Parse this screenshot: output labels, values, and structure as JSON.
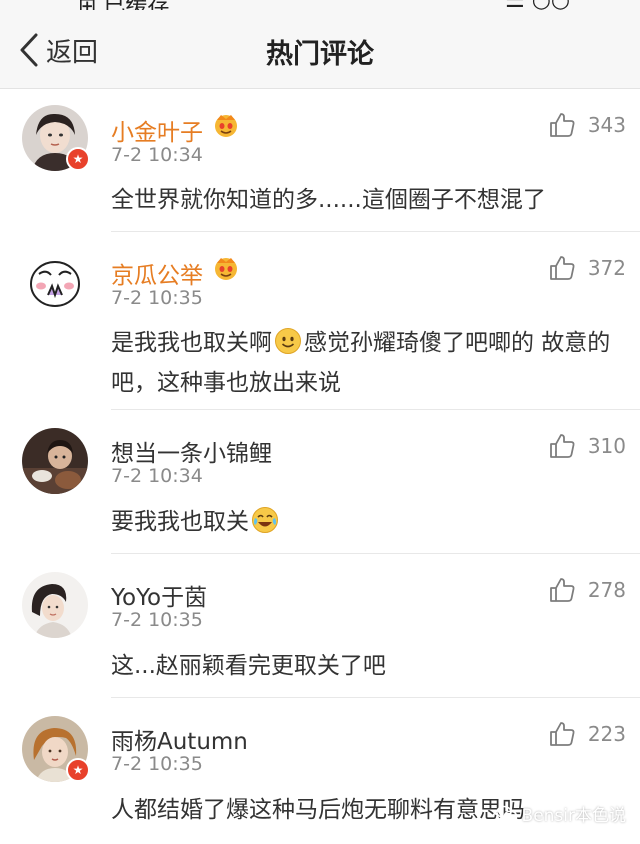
{
  "status_bar": {
    "fragments": [
      "⊞ 已缓存",
      "☰ ○○"
    ]
  },
  "navbar": {
    "back_label": "返回",
    "title": "热门评论"
  },
  "comments": [
    {
      "name": "小金叶子",
      "name_color": "#e67d23",
      "time": "7-2 10:34",
      "likes": "343",
      "text_parts": [
        "全世界就你知道的多......這個圈子不想混了"
      ],
      "has_vip": true,
      "has_badge": true,
      "avatar": "woman-portrait-avatar"
    },
    {
      "name": "京瓜公举",
      "name_color": "#e67d23",
      "time": "7-2 10:35",
      "likes": "372",
      "text_parts": [
        "是我我也取关啊",
        "感觉孙耀琦傻了吧唧的 故意的吧，这种事也放出来说"
      ],
      "has_vip": true,
      "has_badge": false,
      "avatar": "cartoon-blush-avatar"
    },
    {
      "name": "想当一条小锦鲤",
      "name_color": "#333333",
      "time": "7-2 10:34",
      "likes": "310",
      "text_parts": [
        "要我我也取关"
      ],
      "has_vip": false,
      "has_badge": false,
      "avatar": "dark-photo-avatar"
    },
    {
      "name": "YoYo于茵",
      "name_color": "#333333",
      "time": "7-2 10:35",
      "likes": "278",
      "text_parts": [
        "这...赵丽颖看完更取关了吧"
      ],
      "has_vip": false,
      "has_badge": false,
      "avatar": "light-portrait-avatar"
    },
    {
      "name": "雨杨Autumn",
      "name_color": "#333333",
      "time": "7-2 10:35",
      "likes": "223",
      "text_parts": [
        "人都结婚了爆这种马后炮无聊料有意思吗"
      ],
      "has_vip": false,
      "has_badge": true,
      "avatar": "painting-portrait-avatar"
    }
  ],
  "watermark": {
    "text": "Bensir本色说"
  },
  "icons": {
    "back": "chevron-left-icon",
    "like": "thumbs-up-icon",
    "vip": "vip-crown-emoji-icon",
    "smile": "smile-emoji-icon",
    "laugh_cry": "laugh-cry-emoji-icon",
    "verified": "verified-badge-icon"
  },
  "colors": {
    "orange_name": "#e67d23",
    "badge_red": "#e8412b",
    "secondary_text": "#8a8a8a"
  }
}
